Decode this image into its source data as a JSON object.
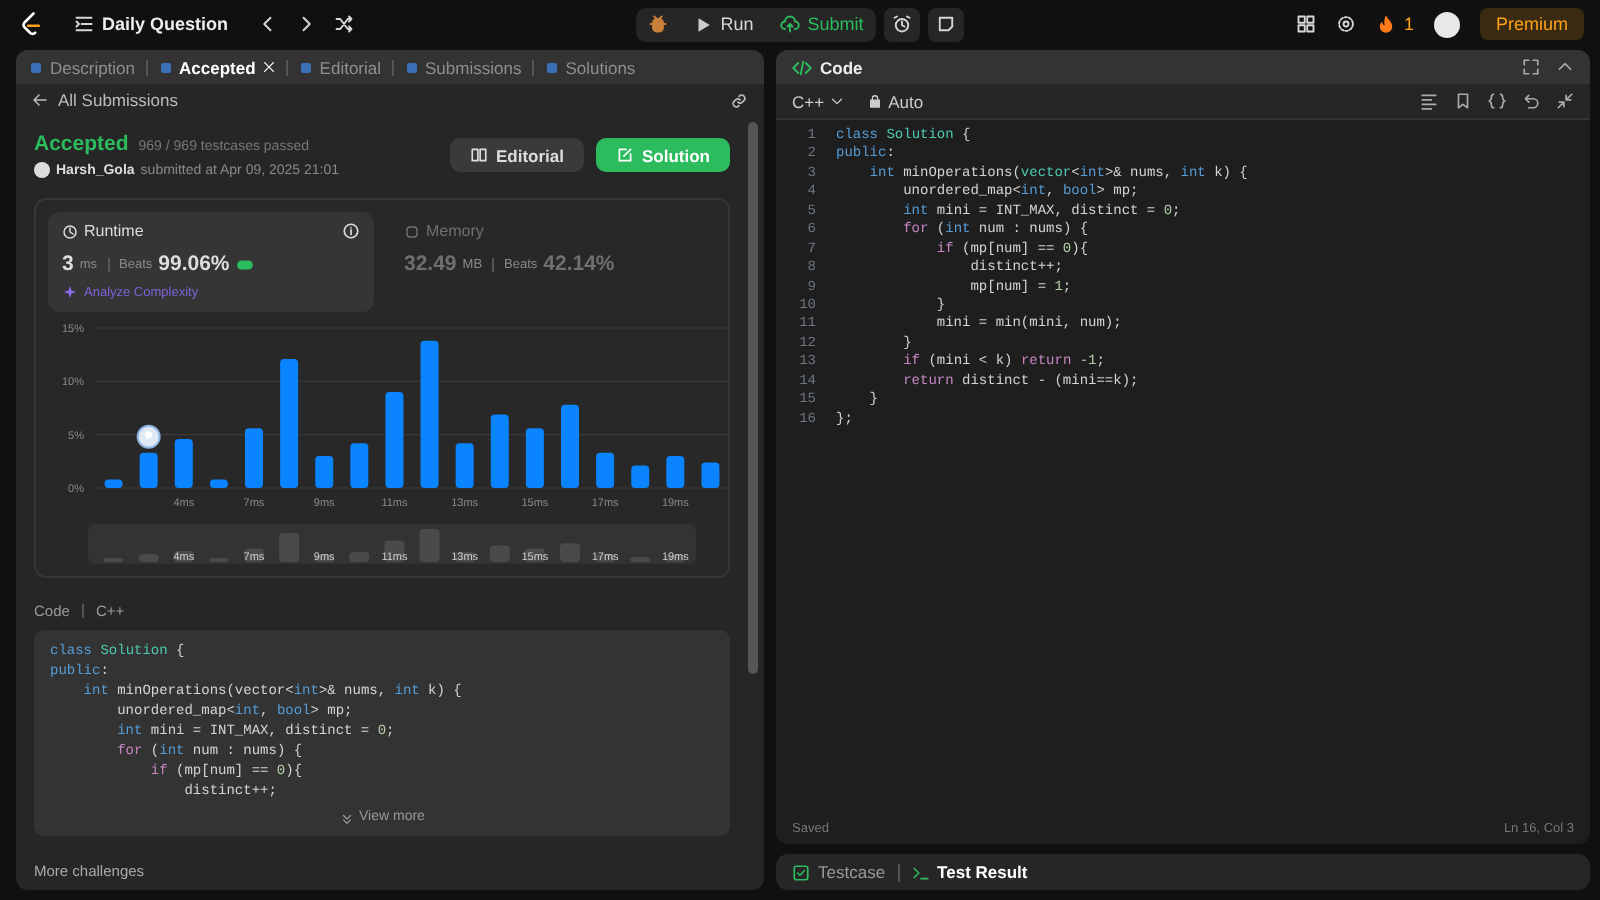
{
  "top_bar": {
    "title": "Daily Question",
    "run_label": "Run",
    "submit_label": "Submit",
    "streak": "1",
    "premium_label": "Premium"
  },
  "left_panel": {
    "tabs": [
      {
        "label": "Description",
        "selected": false,
        "closable": false
      },
      {
        "label": "Accepted",
        "selected": true,
        "closable": true
      },
      {
        "label": "Editorial",
        "selected": false,
        "closable": false
      },
      {
        "label": "Submissions",
        "selected": false,
        "closable": false
      },
      {
        "label": "Solutions",
        "selected": false,
        "closable": false
      }
    ],
    "back_link": "All Submissions",
    "submission": {
      "status": "Accepted",
      "testcases": "969 / 969 testcases passed",
      "user": "Harsh_Gola",
      "submitted": "submitted at Apr 09, 2025 21:01"
    },
    "buttons": [
      {
        "label": "Editorial",
        "kind": "secondary"
      },
      {
        "label": "Solution",
        "kind": "primary"
      }
    ],
    "stats": [
      {
        "kind": "runtime",
        "label": "Runtime",
        "value": "3",
        "unit": "ms",
        "beats_label": "Beats",
        "beats": "99.06%",
        "selected": true
      },
      {
        "kind": "memory",
        "label": "Memory",
        "value": "32.49",
        "unit": "MB",
        "beats_label": "Beats",
        "beats": "42.14%",
        "selected": false
      }
    ],
    "analyze_link": "Analyze Complexity",
    "chart_data": {
      "type": "bar",
      "categories": [
        null,
        null,
        "4ms",
        null,
        "7ms",
        null,
        "9ms",
        null,
        "11ms",
        null,
        "13ms",
        null,
        "15ms",
        null,
        "17ms",
        null,
        "19ms",
        null
      ],
      "values": [
        0.8,
        3.3,
        4.6,
        0.8,
        5.6,
        12.1,
        3.0,
        4.2,
        9.0,
        13.8,
        4.2,
        6.9,
        5.6,
        7.8,
        3.3,
        2.1,
        3.0,
        2.4
      ],
      "ylim": [
        0,
        15
      ],
      "yticks": [
        {
          "value": 0,
          "label": "0%"
        },
        {
          "value": 5,
          "label": "5%"
        },
        {
          "value": 10,
          "label": "10%"
        },
        {
          "value": 15,
          "label": "15%"
        }
      ]
    },
    "bar_markers": [
      {
        "selected": false
      },
      {
        "selected": true
      },
      {
        "selected": false
      },
      {
        "selected": false
      },
      {
        "selected": false
      },
      {
        "selected": false
      },
      {
        "selected": false
      },
      {
        "selected": false
      },
      {
        "selected": false
      },
      {
        "selected": false
      },
      {
        "selected": false
      },
      {
        "selected": false
      },
      {
        "selected": false
      },
      {
        "selected": false
      },
      {
        "selected": false
      },
      {
        "selected": false
      },
      {
        "selected": false
      },
      {
        "selected": false
      }
    ],
    "navigator_labels": [
      "4ms",
      "7ms",
      "9ms",
      "11ms",
      "13ms",
      "15ms",
      "17ms",
      "19ms"
    ],
    "code_label": "Code",
    "code_language": "C++",
    "code_preview": [
      [
        {
          "kind": "keyword",
          "text": "class"
        },
        {
          "kind": "type",
          "text": " Solution"
        },
        {
          "kind": "plain",
          "text": " {"
        }
      ],
      [
        {
          "kind": "keyword",
          "text": "public"
        },
        {
          "kind": "plain",
          "text": ":"
        }
      ],
      [
        {
          "kind": "keyword",
          "text": "    int"
        },
        {
          "kind": "plain",
          "text": " minOperations(vector<"
        },
        {
          "kind": "keyword",
          "text": "int"
        },
        {
          "kind": "plain",
          "text": ">& nums, "
        },
        {
          "kind": "keyword",
          "text": "int"
        },
        {
          "kind": "plain",
          "text": " k) {"
        }
      ],
      [
        {
          "kind": "plain",
          "text": "        unordered_map<"
        },
        {
          "kind": "keyword",
          "text": "int"
        },
        {
          "kind": "plain",
          "text": ", "
        },
        {
          "kind": "keyword",
          "text": "bool"
        },
        {
          "kind": "plain",
          "text": "> mp;"
        }
      ],
      [
        {
          "kind": "keyword",
          "text": "        int"
        },
        {
          "kind": "plain",
          "text": " mini = INT_MAX, distinct = "
        },
        {
          "kind": "number",
          "text": "0"
        },
        {
          "kind": "plain",
          "text": ";"
        }
      ],
      [
        {
          "kind": "control",
          "text": "        for"
        },
        {
          "kind": "plain",
          "text": " ("
        },
        {
          "kind": "keyword",
          "text": "int"
        },
        {
          "kind": "plain",
          "text": " num : nums) {"
        }
      ],
      [
        {
          "kind": "control",
          "text": "            if"
        },
        {
          "kind": "plain",
          "text": " (mp[num] == "
        },
        {
          "kind": "number",
          "text": "0"
        },
        {
          "kind": "plain",
          "text": "){"
        }
      ],
      [
        {
          "kind": "plain",
          "text": "                distinct++;"
        }
      ]
    ],
    "view_more": "View more",
    "more_challenges": "More challenges"
  },
  "editor": {
    "title": "Code",
    "language": "C++",
    "mode": "Auto",
    "status": "Saved",
    "cursor": "Ln 16, Col 3",
    "lines": [
      {
        "number": "1",
        "segments": [
          {
            "kind": "keyword",
            "text": "class"
          },
          {
            "kind": "type",
            "text": " Solution"
          },
          {
            "kind": "plain",
            "text": " {"
          }
        ]
      },
      {
        "number": "2",
        "segments": [
          {
            "kind": "keyword",
            "text": "public"
          },
          {
            "kind": "plain",
            "text": ":"
          }
        ]
      },
      {
        "number": "3",
        "segments": [
          {
            "kind": "keyword",
            "text": "    int"
          },
          {
            "kind": "plain",
            "text": " minOperations("
          },
          {
            "kind": "type",
            "text": "vector"
          },
          {
            "kind": "plain",
            "text": "<"
          },
          {
            "kind": "keyword",
            "text": "int"
          },
          {
            "kind": "plain",
            "text": ">& nums, "
          },
          {
            "kind": "keyword",
            "text": "int"
          },
          {
            "kind": "plain",
            "text": " k) {"
          }
        ]
      },
      {
        "number": "4",
        "segments": [
          {
            "kind": "plain",
            "text": "        unordered_map<"
          },
          {
            "kind": "keyword",
            "text": "int"
          },
          {
            "kind": "plain",
            "text": ", "
          },
          {
            "kind": "keyword",
            "text": "bool"
          },
          {
            "kind": "plain",
            "text": "> mp;"
          }
        ]
      },
      {
        "number": "5",
        "segments": [
          {
            "kind": "keyword",
            "text": "        int"
          },
          {
            "kind": "plain",
            "text": " mini = INT_MAX, distinct = "
          },
          {
            "kind": "number",
            "text": "0"
          },
          {
            "kind": "plain",
            "text": ";"
          }
        ]
      },
      {
        "number": "6",
        "segments": [
          {
            "kind": "control",
            "text": "        for"
          },
          {
            "kind": "plain",
            "text": " ("
          },
          {
            "kind": "keyword",
            "text": "int"
          },
          {
            "kind": "plain",
            "text": " num : nums) {"
          }
        ]
      },
      {
        "number": "7",
        "segments": [
          {
            "kind": "control",
            "text": "            if"
          },
          {
            "kind": "plain",
            "text": " (mp[num] == "
          },
          {
            "kind": "number",
            "text": "0"
          },
          {
            "kind": "plain",
            "text": "){"
          }
        ]
      },
      {
        "number": "8",
        "segments": [
          {
            "kind": "plain",
            "text": "                distinct++;"
          }
        ]
      },
      {
        "number": "9",
        "segments": [
          {
            "kind": "plain",
            "text": "                mp[num] = "
          },
          {
            "kind": "number",
            "text": "1"
          },
          {
            "kind": "plain",
            "text": ";"
          }
        ]
      },
      {
        "number": "10",
        "segments": [
          {
            "kind": "plain",
            "text": "            }"
          }
        ]
      },
      {
        "number": "11",
        "segments": [
          {
            "kind": "plain",
            "text": "            mini = min(mini, num);"
          }
        ]
      },
      {
        "number": "12",
        "segments": [
          {
            "kind": "plain",
            "text": "        }"
          }
        ]
      },
      {
        "number": "13",
        "segments": [
          {
            "kind": "control",
            "text": "        if"
          },
          {
            "kind": "plain",
            "text": " (mini < k) "
          },
          {
            "kind": "control",
            "text": "return"
          },
          {
            "kind": "number",
            "text": " -1"
          },
          {
            "kind": "plain",
            "text": ";"
          }
        ]
      },
      {
        "number": "14",
        "segments": [
          {
            "kind": "control",
            "text": "        return"
          },
          {
            "kind": "plain",
            "text": " distinct - (mini==k);"
          }
        ]
      },
      {
        "number": "15",
        "segments": [
          {
            "kind": "plain",
            "text": "    }"
          }
        ]
      },
      {
        "number": "16",
        "segments": [
          {
            "kind": "plain",
            "text": "};"
          }
        ]
      }
    ]
  },
  "bottom_panel": {
    "tabs": [
      {
        "label": "Testcase",
        "selected": false
      },
      {
        "label": "Test Result",
        "selected": true
      }
    ]
  }
}
